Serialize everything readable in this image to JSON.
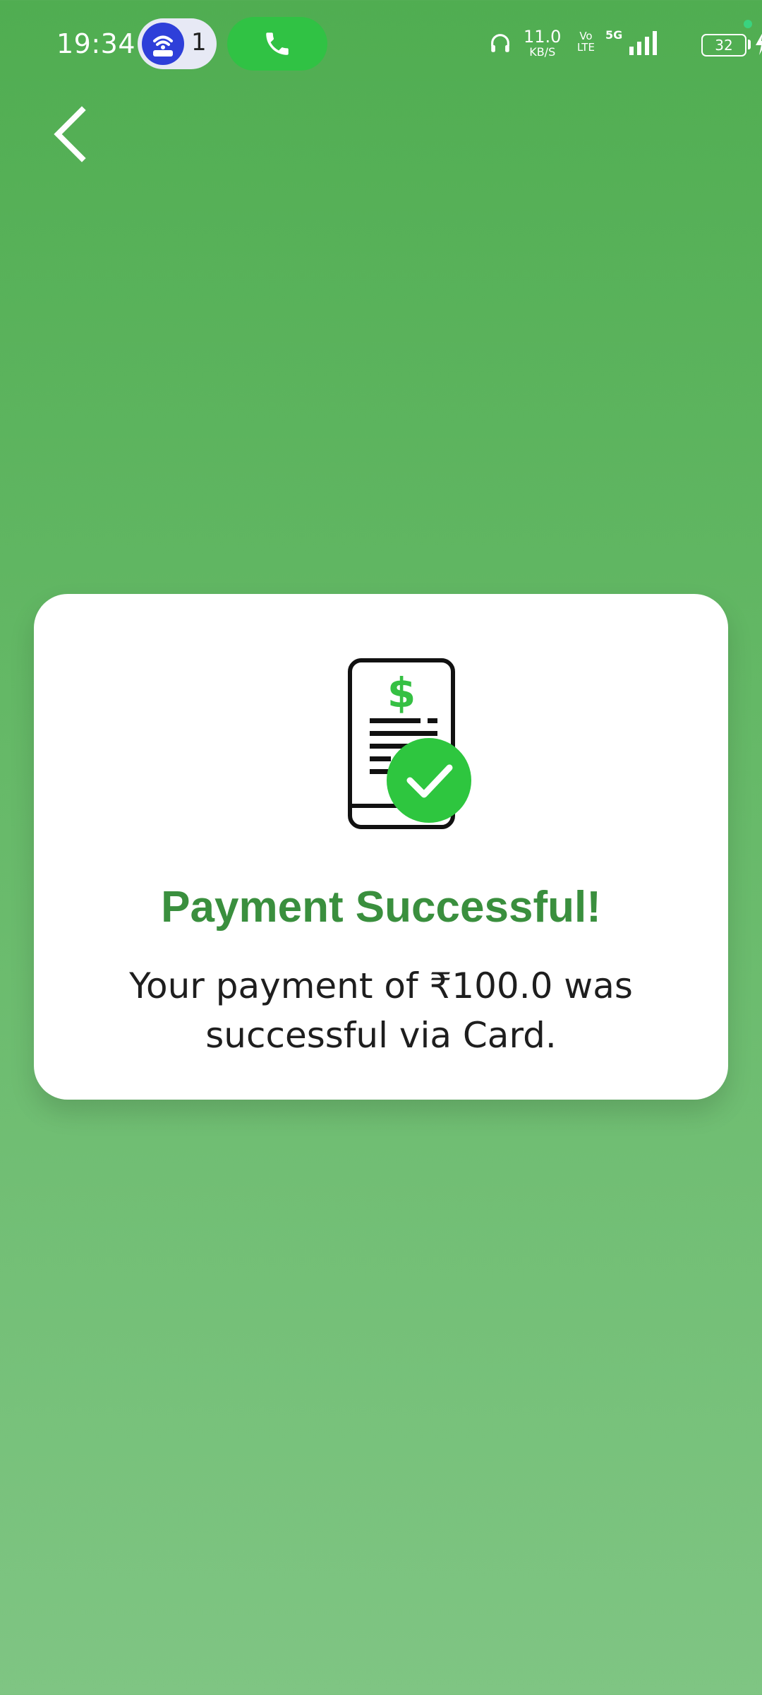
{
  "status_bar": {
    "time": "19:34",
    "hotspot_count": "1",
    "net_speed_value": "11.0",
    "net_speed_unit": "KB/S",
    "volte_top": "Vo",
    "volte_bottom": "LTE",
    "network_type": "5G",
    "battery_level": "32"
  },
  "colors": {
    "background_top": "#50ad51",
    "background_bottom": "#7fc583",
    "title": "#3a8f3e",
    "check_badge": "#2ec63f",
    "dollar": "#35c043"
  },
  "icons": {
    "back": "back-arrow-icon",
    "receipt": "receipt-icon",
    "check": "check-circle-icon",
    "call": "phone-icon",
    "hotspot": "hotspot-icon"
  },
  "card": {
    "title": "Payment Successful!",
    "message": "Your payment of ₹100.0 was successful via Card."
  }
}
